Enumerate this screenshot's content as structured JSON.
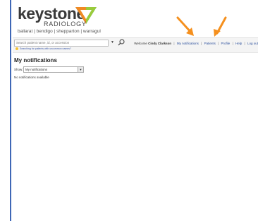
{
  "header": {
    "logo_word": "keystone",
    "logo_sub": "RADIOLOGY",
    "logo_locations": "ballarat | bendigo | shepparton | warragul"
  },
  "toolbar": {
    "search_placeholder": "Search patient name, id, or accession",
    "search_hint": "Searching for patients with uncommon names?"
  },
  "topnav": {
    "welcome_prefix": "Welcome",
    "user_name": "Cindy Clarkson",
    "items": [
      "My notifications",
      "Patients",
      "Profile",
      "Help",
      "Log out"
    ]
  },
  "page": {
    "title": "My notifications",
    "show_label": "Show:",
    "show_value": "My notifications",
    "empty_message": "No notifications available"
  },
  "colors": {
    "accent_border": "#3f67b6",
    "arrow": "#f5901e"
  }
}
